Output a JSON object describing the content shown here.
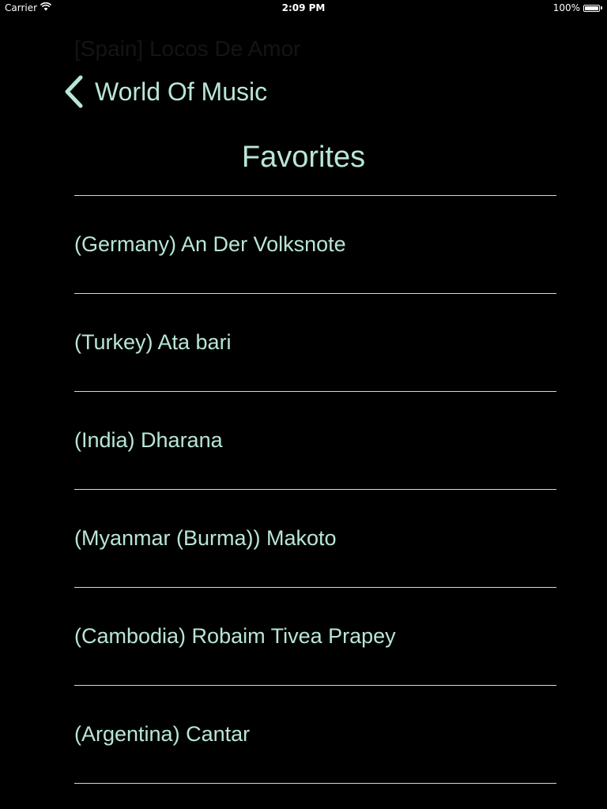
{
  "status_bar": {
    "carrier": "Carrier",
    "time": "2:09 PM",
    "battery": "100%",
    "battery_level": 1.0
  },
  "ghost_title": "[Spain] Locos De Amor",
  "nav": {
    "back_label": "World Of Music"
  },
  "page_title": "Favorites",
  "favorites": [
    {
      "label": "(Germany) An Der Volksnote"
    },
    {
      "label": "(Turkey) Ata bari"
    },
    {
      "label": "(India) Dharana"
    },
    {
      "label": "(Myanmar (Burma)) Makoto"
    },
    {
      "label": "(Cambodia) Robaim Tivea Prapey"
    },
    {
      "label": "(Argentina) Cantar"
    }
  ],
  "colors": {
    "accent": "#b8e6d6",
    "background": "#000000",
    "status_text": "#ffffff"
  },
  "icons": {
    "wifi": "wifi-icon",
    "battery": "battery-icon",
    "back": "chevron-left-icon"
  }
}
